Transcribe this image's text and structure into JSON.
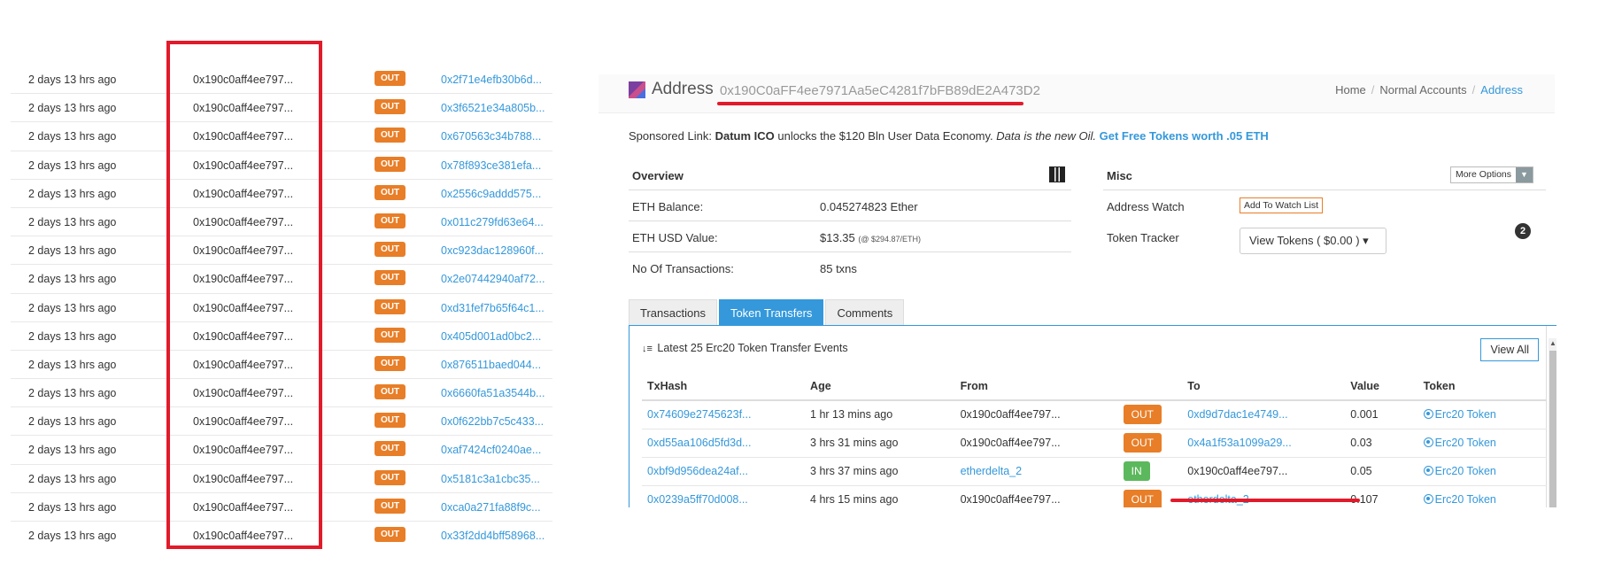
{
  "left_list": {
    "rows": [
      {
        "age": "2 days 13 hrs ago",
        "from": "0x190c0aff4ee797...",
        "dir": "OUT",
        "to": "0x2f71e4efb30b6d..."
      },
      {
        "age": "2 days 13 hrs ago",
        "from": "0x190c0aff4ee797...",
        "dir": "OUT",
        "to": "0x3f6521e34a805b..."
      },
      {
        "age": "2 days 13 hrs ago",
        "from": "0x190c0aff4ee797...",
        "dir": "OUT",
        "to": "0x670563c34b788..."
      },
      {
        "age": "2 days 13 hrs ago",
        "from": "0x190c0aff4ee797...",
        "dir": "OUT",
        "to": "0x78f893ce381efa..."
      },
      {
        "age": "2 days 13 hrs ago",
        "from": "0x190c0aff4ee797...",
        "dir": "OUT",
        "to": "0x2556c9addd575..."
      },
      {
        "age": "2 days 13 hrs ago",
        "from": "0x190c0aff4ee797...",
        "dir": "OUT",
        "to": "0x011c279fd63e64..."
      },
      {
        "age": "2 days 13 hrs ago",
        "from": "0x190c0aff4ee797...",
        "dir": "OUT",
        "to": "0xc923dac128960f..."
      },
      {
        "age": "2 days 13 hrs ago",
        "from": "0x190c0aff4ee797...",
        "dir": "OUT",
        "to": "0x2e07442940af72..."
      },
      {
        "age": "2 days 13 hrs ago",
        "from": "0x190c0aff4ee797...",
        "dir": "OUT",
        "to": "0xd31fef7b65f64c1..."
      },
      {
        "age": "2 days 13 hrs ago",
        "from": "0x190c0aff4ee797...",
        "dir": "OUT",
        "to": "0x405d001ad0bc2..."
      },
      {
        "age": "2 days 13 hrs ago",
        "from": "0x190c0aff4ee797...",
        "dir": "OUT",
        "to": "0x876511baed044..."
      },
      {
        "age": "2 days 13 hrs ago",
        "from": "0x190c0aff4ee797...",
        "dir": "OUT",
        "to": "0x6660fa51a3544b..."
      },
      {
        "age": "2 days 13 hrs ago",
        "from": "0x190c0aff4ee797...",
        "dir": "OUT",
        "to": "0x0f622bb7c5c433..."
      },
      {
        "age": "2 days 13 hrs ago",
        "from": "0x190c0aff4ee797...",
        "dir": "OUT",
        "to": "0xaf7424cf0240ae..."
      },
      {
        "age": "2 days 13 hrs ago",
        "from": "0x190c0aff4ee797...",
        "dir": "OUT",
        "to": "0x5181c3a1cbc35..."
      },
      {
        "age": "2 days 13 hrs ago",
        "from": "0x190c0aff4ee797...",
        "dir": "OUT",
        "to": "0xca0a271fa88f9c..."
      },
      {
        "age": "2 days 13 hrs ago",
        "from": "0x190c0aff4ee797...",
        "dir": "OUT",
        "to": "0x33f2dd4bff58968..."
      }
    ]
  },
  "header": {
    "label": "Address",
    "address": "0x190C0aFF4ee7971Aa5eC4281f7bFB89dE2A473D2",
    "breadcrumb": {
      "home": "Home",
      "section": "Normal Accounts",
      "current": "Address"
    }
  },
  "sponsored": {
    "prefix": "Sponsored Link:",
    "brand": "Datum ICO",
    "text": "unlocks the $120 Bln User Data Economy.",
    "tagline": "Data is the new Oil.",
    "cta": "Get Free Tokens worth .05 ETH"
  },
  "overview": {
    "title": "Overview",
    "rows": [
      {
        "key": "ETH Balance:",
        "value": "0.045274823 Ether",
        "note": ""
      },
      {
        "key": "ETH USD Value:",
        "value": "$13.35",
        "note": "(@ $294.87/ETH)"
      },
      {
        "key": "No Of Transactions:",
        "value": "85 txns",
        "note": ""
      }
    ]
  },
  "misc": {
    "title": "Misc",
    "more_options": "More Options",
    "address_watch_label": "Address Watch",
    "watch_button": "Add To Watch List",
    "token_tracker_label": "Token Tracker",
    "view_tokens": "View Tokens ( $0.00 )",
    "token_count": "2"
  },
  "tabs": [
    "Transactions",
    "Token Transfers",
    "Comments"
  ],
  "token_transfers": {
    "title": "Latest 25 Erc20 Token Transfer Events",
    "view_all": "View All",
    "columns": [
      "TxHash",
      "Age",
      "From",
      "",
      "To",
      "Value",
      "Token"
    ],
    "rows": [
      {
        "hash": "0x74609e2745623f...",
        "age": "1 hr 13 mins ago",
        "from": "0x190c0aff4ee797...",
        "dir": "OUT",
        "to": "0xd9d7dac1e4749...",
        "value": "0.001",
        "token": "Erc20 Token"
      },
      {
        "hash": "0xd55aa106d5fd3d...",
        "age": "3 hrs 31 mins ago",
        "from": "0x190c0aff4ee797...",
        "dir": "OUT",
        "to": "0x4a1f53a1099a29...",
        "value": "0.03",
        "token": "Erc20 Token"
      },
      {
        "hash": "0xbf9d956dea24af...",
        "age": "3 hrs 37 mins ago",
        "from": "etherdelta_2",
        "dir": "IN",
        "to": "0x190c0aff4ee797...",
        "value": "0.05",
        "token": "Erc20 Token"
      },
      {
        "hash": "0x0239a5ff70d008...",
        "age": "4 hrs 15 mins ago",
        "from": "0x190c0aff4ee797...",
        "dir": "OUT",
        "to": "etherdelta_2",
        "value": "0.107",
        "token": "Erc20 Token"
      }
    ]
  },
  "colors": {
    "accent": "#3498db",
    "out_badge": "#e87e28",
    "in_badge": "#5cb85c",
    "highlight": "#e21a2a"
  }
}
